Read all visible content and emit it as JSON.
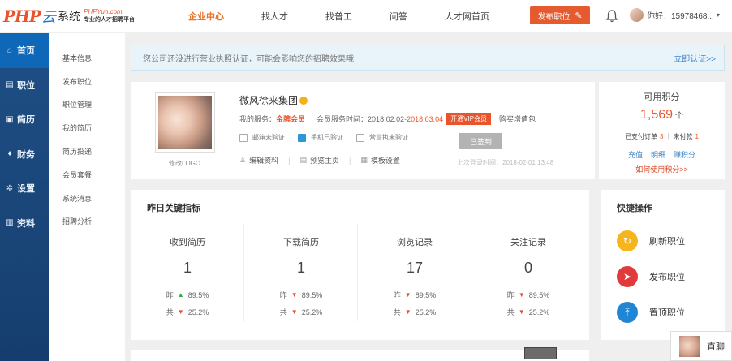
{
  "brand": {
    "php": "PHP",
    "yun": "云",
    "sys": "系统",
    "url": "PHPYun.com",
    "tagline": "专业的人才招聘平台"
  },
  "topnav": [
    "企业中心",
    "找人才",
    "找普工",
    "问答",
    "人才网首页"
  ],
  "post_button": "发布职位",
  "user_greeting": "你好！15978468...",
  "sidebar": [
    "首页",
    "职位",
    "简历",
    "财务",
    "设置",
    "资料"
  ],
  "submenu": [
    "基本信息",
    "发布职位",
    "职位管理",
    "我的简历",
    "简历投递",
    "会员套餐",
    "系统消息",
    "招聘分析"
  ],
  "notice": {
    "message": "您公司还没进行营业执照认证，可能会影响您的招聘效果哦",
    "link": "立即认证>>"
  },
  "company": {
    "name": "微风徐来集团",
    "logo_edit": "修改LOGO",
    "service_label": "我的服务：",
    "service_level": "金牌会员",
    "period_label": "会员服务时间：",
    "period_start": "2018.02.02",
    "period_end": "-2018.03.04",
    "vip_button": "开通VIP会员",
    "buy_value": "购买增值包",
    "verifications": [
      "邮箱未验证",
      "手机已验证",
      "营业执未验证"
    ],
    "checkin": "已签到",
    "actions": [
      "编辑资料",
      "预览主页",
      "模板设置"
    ],
    "last_login": "上次登录时间：2018-02-01 13:48"
  },
  "credits": {
    "title": "可用积分",
    "value": "1,569",
    "unit": "个",
    "paid_label": "已支付订单",
    "paid_count": "3",
    "unpaid_label": "未付款",
    "unpaid_count": "1",
    "links": [
      "充值",
      "明细",
      "赚积分"
    ],
    "how_to": "如何使用积分>>"
  },
  "metrics": {
    "title": "昨日关键指标",
    "items": [
      {
        "label": "收到简历",
        "value": "1",
        "yesterday": "89.5%",
        "total": "25.2%",
        "y_trend": "up"
      },
      {
        "label": "下载简历",
        "value": "1",
        "yesterday": "89.5%",
        "total": "25.2%",
        "y_trend": "down"
      },
      {
        "label": "浏览记录",
        "value": "17",
        "yesterday": "89.5%",
        "total": "25.2%",
        "y_trend": "down"
      },
      {
        "label": "关注记录",
        "value": "0",
        "yesterday": "89.5%",
        "total": "25.2%",
        "y_trend": "down"
      }
    ],
    "yesterday_label": "昨",
    "total_label": "共"
  },
  "quick": {
    "title": "快捷操作",
    "items": [
      {
        "label": "刷新职位",
        "icon": "refresh-icon",
        "color": "#f5b51c"
      },
      {
        "label": "发布职位",
        "icon": "paper-plane-icon",
        "color": "#e23a3a"
      },
      {
        "label": "置顶职位",
        "icon": "pin-top-icon",
        "color": "#1f86d6"
      }
    ]
  },
  "chat_label": "直聊",
  "colors": {
    "accent": "#e8542b",
    "sidebar": "#1f4f86",
    "link": "#3a86c8"
  }
}
